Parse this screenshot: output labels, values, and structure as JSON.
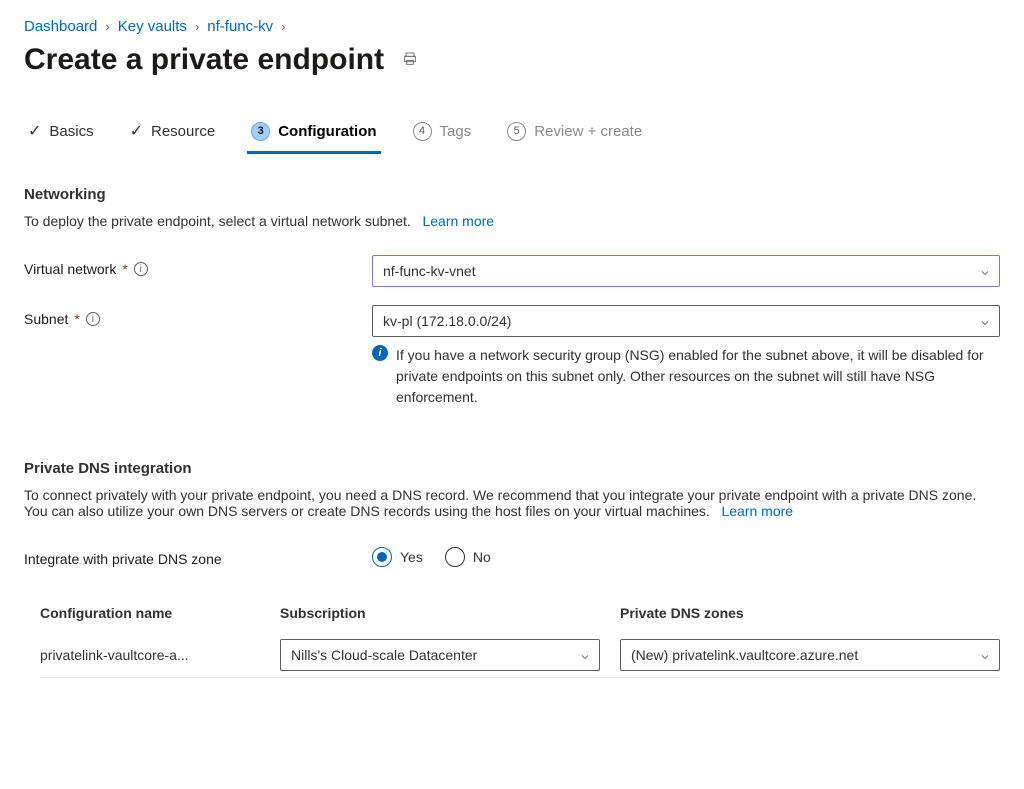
{
  "breadcrumb": {
    "items": [
      {
        "label": "Dashboard"
      },
      {
        "label": "Key vaults"
      },
      {
        "label": "nf-func-kv"
      }
    ]
  },
  "page": {
    "title": "Create a private endpoint"
  },
  "tabs": {
    "items": [
      {
        "label": "Basics",
        "state": "done"
      },
      {
        "label": "Resource",
        "state": "done"
      },
      {
        "label": "Configuration",
        "state": "active",
        "badge": "3"
      },
      {
        "label": "Tags",
        "state": "future",
        "badge": "4"
      },
      {
        "label": "Review + create",
        "state": "future",
        "badge": "5"
      }
    ]
  },
  "networking": {
    "heading": "Networking",
    "description": "To deploy the private endpoint, select a virtual network subnet.",
    "learnMore": "Learn more",
    "virtualNetwork": {
      "label": "Virtual network",
      "value": "nf-func-kv-vnet"
    },
    "subnet": {
      "label": "Subnet",
      "value": "kv-pl (172.18.0.0/24)",
      "hint": "If you have a network security group (NSG) enabled for the subnet above, it will be disabled for private endpoints on this subnet only. Other resources on the subnet will still have NSG enforcement."
    }
  },
  "dns": {
    "heading": "Private DNS integration",
    "description": "To connect privately with your private endpoint, you need a DNS record. We recommend that you integrate your private endpoint with a private DNS zone. You can also utilize your own DNS servers or create DNS records using the host files on your virtual machines.",
    "learnMore": "Learn more",
    "integrateLabel": "Integrate with private DNS zone",
    "yes": "Yes",
    "no": "No",
    "selected": "yes",
    "table": {
      "headers": {
        "config": "Configuration name",
        "subscription": "Subscription",
        "zones": "Private DNS zones"
      },
      "row": {
        "configName": "privatelink-vaultcore-a...",
        "subscription": "Nills's Cloud-scale Datacenter",
        "zone": "(New) privatelink.vaultcore.azure.net"
      }
    }
  }
}
